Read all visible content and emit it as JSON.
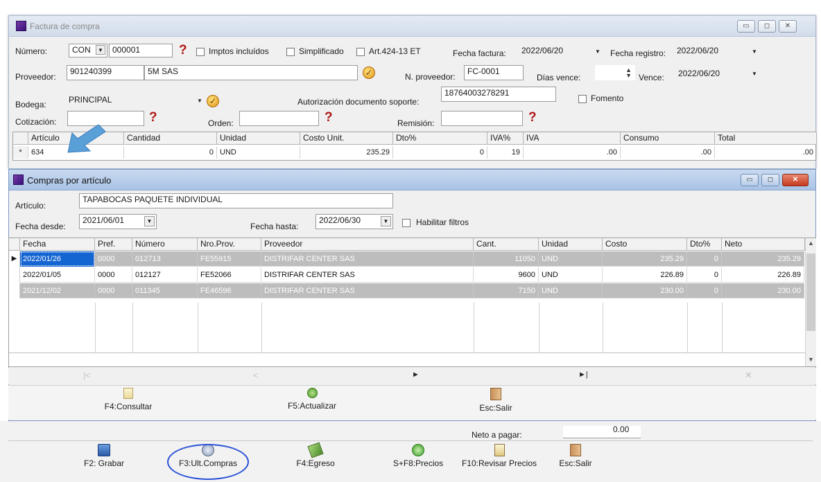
{
  "factura": {
    "title": "Factura de compra",
    "numero_label": "Número:",
    "numero_prefix": "CON",
    "numero_value": "000001",
    "imptos_label": "Imptos incluídos",
    "simplificado_label": "Simplificado",
    "art_label": "Art.424-13 ET",
    "fecha_factura_label": "Fecha factura:",
    "fecha_factura": "2022/06/20",
    "fecha_registro_label": "Fecha registro:",
    "fecha_registro": "2022/06/20",
    "proveedor_label": "Proveedor:",
    "proveedor_nit": "901240399",
    "proveedor_nombre": "5M SAS",
    "n_proveedor_label": "N. proveedor:",
    "n_proveedor": "FC-0001",
    "dias_vence_label": "Días vence:",
    "vence_label": "Vence:",
    "vence": "2022/06/20",
    "bodega_label": "Bodega:",
    "bodega": "PRINCIPAL",
    "autorizacion_label": "Autorización documento soporte:",
    "autorizacion": "18764003278291",
    "fomento_label": "Fomento",
    "cotizacion_label": "Cotización:",
    "orden_label": "Orden:",
    "remision_label": "Remisión:",
    "grid_headers": [
      "Artículo",
      "Cantidad",
      "Unidad",
      "Costo Unit.",
      "Dto%",
      "IVA%",
      "IVA",
      "Consumo",
      "Total"
    ],
    "grid_row": {
      "marker": "*",
      "articulo": "634",
      "cantidad": "0",
      "unidad": "UND",
      "costo": "235.29",
      "dto": "0",
      "iva_pct": "19",
      "iva": ".00",
      "consumo": ".00",
      "total": ".00"
    }
  },
  "compras": {
    "title": "Compras por artículo",
    "articulo_label": "Artículo:",
    "articulo": "TAPABOCAS PAQUETE INDIVIDUAL",
    "fecha_desde_label": "Fecha desde:",
    "fecha_desde": "2021/06/01",
    "fecha_hasta_label": "Fecha hasta:",
    "fecha_hasta": "2022/06/30",
    "habilitar_label": "Habilitar filtros",
    "headers": [
      "Fecha",
      "Pref.",
      "Número",
      "Nro.Prov.",
      "Proveedor",
      "Cant.",
      "Unidad",
      "Costo",
      "Dto%",
      "Neto"
    ],
    "rows": [
      {
        "fecha": "2022/01/26",
        "pref": "0000",
        "numero": "012713",
        "nroprov": "FE55915",
        "proveedor": "DISTRIFAR CENTER SAS",
        "cant": "11050",
        "unidad": "UND",
        "costo": "235.29",
        "dto": "0",
        "neto": "235.29"
      },
      {
        "fecha": "2022/01/05",
        "pref": "0000",
        "numero": "012127",
        "nroprov": "FE52066",
        "proveedor": "DISTRIFAR CENTER SAS",
        "cant": "9600",
        "unidad": "UND",
        "costo": "226.89",
        "dto": "0",
        "neto": "226.89"
      },
      {
        "fecha": "2021/12/02",
        "pref": "0000",
        "numero": "011345",
        "nroprov": "FE46596",
        "proveedor": "DISTRIFAR CENTER SAS",
        "cant": "7150",
        "unidad": "UND",
        "costo": "230.00",
        "dto": "0",
        "neto": "230.00"
      }
    ],
    "btn_consultar": "F4:Consultar",
    "btn_actualizar": "F5:Actualizar",
    "btn_salir": "Esc:Salir"
  },
  "footer": {
    "neto_label": "Neto a pagar:",
    "neto_value": "0.00",
    "btn_grabar": "F2: Grabar",
    "btn_ultcompras": "F3:Ult.Compras",
    "btn_egreso": "F4:Egreso",
    "btn_precios": "S+F8:Precios",
    "btn_revisar": "F10:Revisar Precios",
    "btn_salir": "Esc:Salir"
  },
  "colors": {
    "highlight_row": "#bdbdbd",
    "selection": "#1464d2",
    "annotation": "#2a52d8",
    "arrow": "#5aa0d8"
  }
}
